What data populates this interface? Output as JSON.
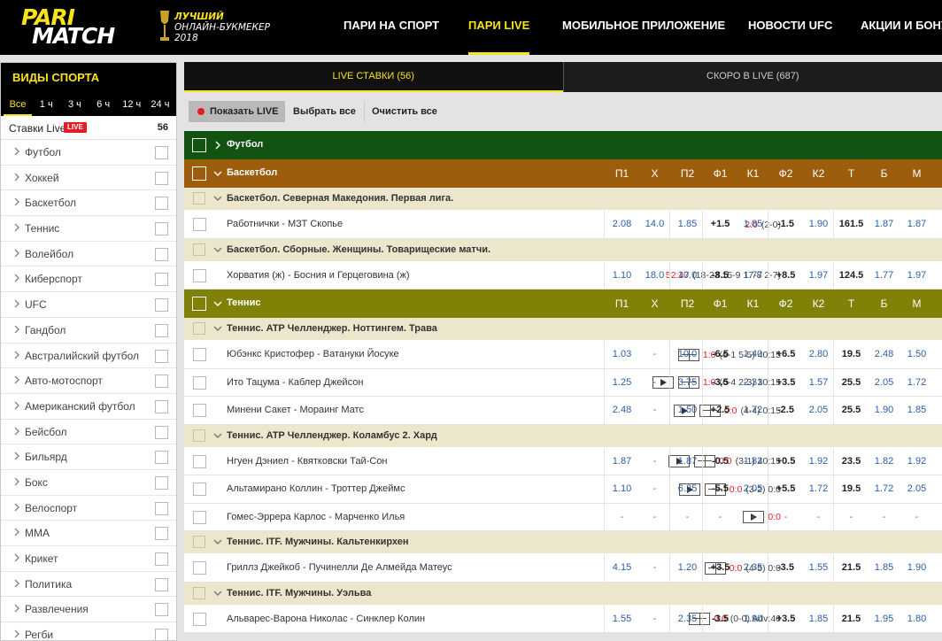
{
  "header": {
    "logo_line1": "PARI",
    "logo_line2": "MATCH",
    "award_line1": "ЛУЧШИЙ",
    "award_line2": "ОНЛАЙН-БУКМЕКЕР",
    "award_line3": "2018",
    "nav": [
      {
        "label": "ПАРИ НА СПОРТ",
        "active": false
      },
      {
        "label": "ПАРИ LIVE",
        "active": true
      },
      {
        "label": "МОБИЛЬНОЕ ПРИЛОЖЕНИЕ",
        "active": false
      },
      {
        "label": "НОВОСТИ UFC",
        "active": false
      },
      {
        "label": "АКЦИИ И БОНУ",
        "active": false
      }
    ]
  },
  "sidebar": {
    "title": "ВИДЫ СПОРТА",
    "periods": [
      "Все",
      "1 ч",
      "3 ч",
      "6 ч",
      "12 ч",
      "24 ч"
    ],
    "active_period": "Все",
    "live_label": "Ставки Live",
    "live_badge": "LIVE",
    "live_count": "56",
    "sports": [
      "Футбол",
      "Хоккей",
      "Баскетбол",
      "Теннис",
      "Волейбол",
      "Киберспорт",
      "UFC",
      "Гандбол",
      "Австралийский футбол",
      "Авто-мотоспорт",
      "Американский футбол",
      "Бейсбол",
      "Бильярд",
      "Бокс",
      "Велоспорт",
      "MMA",
      "Крикет",
      "Политика",
      "Развлечения",
      "Регби"
    ]
  },
  "tabs": [
    {
      "label": "LIVE СТАВКИ (56)",
      "active": true
    },
    {
      "label": "СКОРО В LIVE (687)",
      "active": false
    }
  ],
  "toolbar": {
    "show_live": "Показать LIVE",
    "select_all": "Выбрать все",
    "clear_all": "Очистить все"
  },
  "columns": [
    "П1",
    "Х",
    "П2",
    "Ф1",
    "К1",
    "Ф2",
    "К2",
    "Т",
    "Б",
    "М"
  ],
  "colors": {
    "brand_yellow": "#f8e41a",
    "football_band": "#135311",
    "basketball_band": "#9c5e0d",
    "tennis_band": "#808207",
    "league_row": "#ece6cd",
    "live_red": "#e11d25",
    "odds_blue": "#2b5ea7"
  },
  "rows": [
    {
      "type": "band",
      "title": "Футбол",
      "color": "#135311",
      "headers": false,
      "collapsed": true
    },
    {
      "type": "band",
      "title": "Баскетбол",
      "color": "#9c5e0d",
      "headers": true
    },
    {
      "type": "league",
      "title": "Баскетбол. Северная Македония. Первая лига."
    },
    {
      "type": "match",
      "title": "Работнички - МЗТ Скопье",
      "icons": [],
      "score": "2:0",
      "detail": "(2-0)",
      "odds": [
        "2.08",
        "14.0",
        "1.85",
        "+1.5",
        "1.85",
        "-1.5",
        "1.90",
        "161.5",
        "1.87",
        "1.87"
      ]
    },
    {
      "type": "league",
      "title": "Баскетбол. Сборные. Женщины. Товарищеские матчи."
    },
    {
      "type": "match",
      "title": "Хорватия (ж) - Босния и Герцеговина (ж)",
      "icons": [],
      "score": "52:47",
      "detail": "(18-23 15-9 17-8 2-7)",
      "odds": [
        "1.10",
        "18.0",
        "10.0",
        "-8.5",
        "1.77",
        "+8.5",
        "1.97",
        "124.5",
        "1.77",
        "1.97"
      ]
    },
    {
      "type": "band",
      "title": "Теннис",
      "color": "#808207",
      "headers": true
    },
    {
      "type": "league",
      "title": "Теннис. ATP Челленджер. Ноттингем. Трава"
    },
    {
      "type": "match",
      "title": "Юбэнкс Кристофер - Ватануки Йосуке",
      "icons": [
        "court"
      ],
      "score": "1:0",
      "detail": "(6-1 5-5) 40:15",
      "odds": [
        "1.03",
        "-",
        "10.0",
        "-6.5",
        "1.40",
        "+6.5",
        "2.80",
        "19.5",
        "2.48",
        "1.50"
      ]
    },
    {
      "type": "match",
      "title": "Ито Тацума - Каблер Джейсон",
      "icons": [
        "play",
        "court"
      ],
      "score": "1:0",
      "detail": "(6-4 2-3) 30:15",
      "odds": [
        "1.25",
        "-",
        "3.75",
        "-3.5",
        "2.31",
        "+3.5",
        "1.57",
        "25.5",
        "2.05",
        "1.72"
      ]
    },
    {
      "type": "match",
      "title": "Минени Сакет - Мораинг Матс",
      "icons": [
        "play",
        "court"
      ],
      "score": "0:0",
      "detail": "(4-4) 0:15",
      "odds": [
        "2.48",
        "-",
        "1.50",
        "+2.5",
        "1.72",
        "-2.5",
        "2.05",
        "25.5",
        "1.90",
        "1.85"
      ]
    },
    {
      "type": "league",
      "title": "Теннис. ATP Челленджер. Коламбус 2. Хард"
    },
    {
      "type": "match",
      "title": "Нгуен Дэниел - Квятковски Тай-Сон",
      "icons": [
        "play",
        "court"
      ],
      "score": "0:0",
      "detail": "(3-1) 40:15",
      "odds": [
        "1.87",
        "-",
        "1.87",
        "-0.5",
        "1.82",
        "+0.5",
        "1.92",
        "23.5",
        "1.82",
        "1.92"
      ]
    },
    {
      "type": "match",
      "title": "Альтамирано Коллин - Троттер Джеймс",
      "icons": [
        "play",
        "court"
      ],
      "score": "0:0",
      "detail": "(3-2) 0:0",
      "odds": [
        "1.10",
        "-",
        "6.25",
        "-5.5",
        "2.05",
        "+5.5",
        "1.72",
        "19.5",
        "1.72",
        "2.05"
      ]
    },
    {
      "type": "match",
      "title": "Гомес-Эррера Карлос - Марченко Илья",
      "icons": [
        "play"
      ],
      "score": "0:0",
      "detail": "",
      "odds": [
        "-",
        "-",
        "-",
        "-",
        "-",
        "-",
        "-",
        "-",
        "-",
        "-"
      ]
    },
    {
      "type": "league",
      "title": "Теннис. ITF. Мужчины. Кальтенкирхен"
    },
    {
      "type": "match",
      "title": "Гриллз Джейкоб - Пучинелли Де Алмейда Матеус",
      "icons": [
        "court"
      ],
      "score": "0:0",
      "detail": "(4-5) 0:0",
      "odds": [
        "4.15",
        "-",
        "1.20",
        "+3.5",
        "2.35",
        "-3.5",
        "1.55",
        "21.5",
        "1.85",
        "1.90"
      ]
    },
    {
      "type": "league",
      "title": "Теннис. ITF. Мужчины. Уэльва"
    },
    {
      "type": "match",
      "title": "Альварес-Варона Николас - Синклер Колин",
      "icons": [
        "court"
      ],
      "score": "0:0",
      "detail": "(0-0) Adv:40",
      "odds": [
        "1.55",
        "-",
        "2.35",
        "-3.5",
        "1.90",
        "+3.5",
        "1.85",
        "21.5",
        "1.95",
        "1.80"
      ]
    }
  ]
}
